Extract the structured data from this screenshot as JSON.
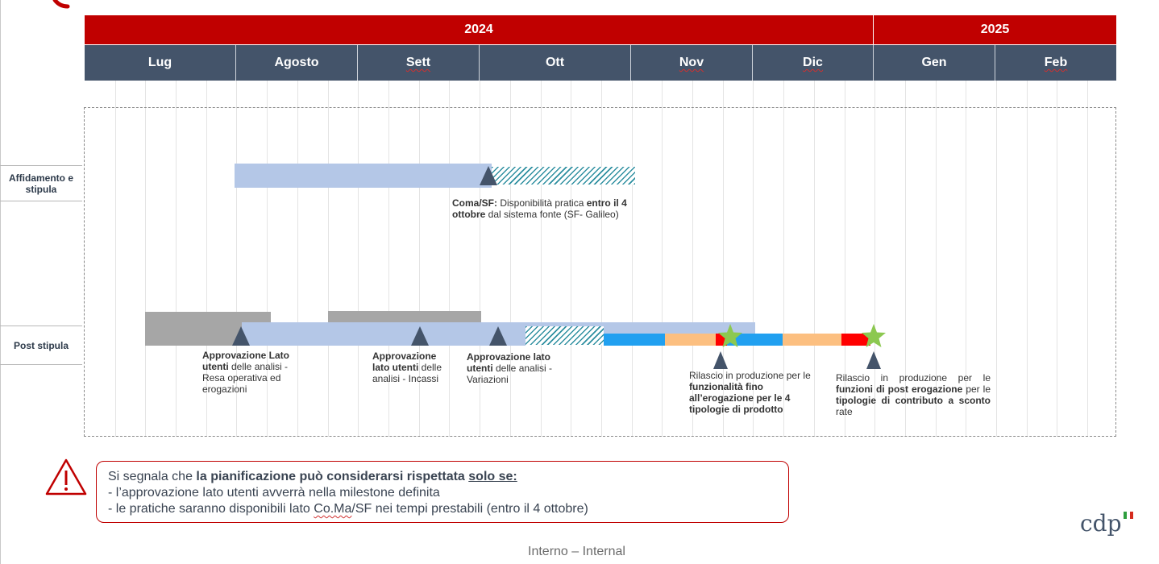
{
  "timeline": {
    "years": [
      "2024",
      "2025"
    ],
    "months": [
      "Lug",
      "Agosto",
      "Sett",
      "Ott",
      "Nov",
      "Dic",
      "Gen",
      "Feb"
    ]
  },
  "rows": {
    "affidamento": "Affidamento e stipula",
    "post": "Post stipula"
  },
  "annotations": {
    "coma_strong": "Coma/SF:",
    "coma_text1": " Disponibilità pratica ",
    "coma_strong2": "entro il 4 ottobre",
    "coma_text2": " dal sistema fonte (SF- Galileo)",
    "appr1_strong": "Approvazione Lato utenti",
    "appr1_text": " delle analisi - Resa operativa ed erogazioni",
    "appr2_strong": "Approvazione lato utenti",
    "appr2_text": " delle analisi - Incassi",
    "appr3_strong": "Approvazione lato utenti",
    "appr3_text": " delle analisi - Variazioni",
    "ril1_text": "Rilascio in produzione per le ",
    "ril1_strong": "funzionalità fino all’erogazione per le 4 tipologie di prodotto",
    "ril2_text": "Rilascio in produzione per le ",
    "ril2_strong": "funzioni di post erogazione",
    "ril2_text2": " per le ",
    "ril2_strong2": "tipologie di contributo a sconto",
    "ril2_text3": " rate"
  },
  "warning": {
    "line1_a": "Si segnala che ",
    "line1_b": "la pianificazione può considerarsi rispettata ",
    "line1_c": "solo se:",
    "line2": "- l’approvazione lato utenti avverrà nella milestone definita",
    "line3_a": "- le pratiche saranno disponibili lato ",
    "line3_b": "Co.Ma",
    "line3_c": "/SF nei tempi prestabili (entro il 4 ottobre)"
  },
  "footer": "Interno – Internal",
  "logo": "cdp",
  "colors": {
    "header_red": "#c00000",
    "month_blue": "#44546a",
    "bar_light_blue": "#b4c7e7",
    "bar_grey": "#a6a6a6",
    "bar_blue": "#21a0f0",
    "bar_orange": "#fcbf80",
    "bar_red": "#ff0000",
    "star_green": "#8cc850"
  }
}
